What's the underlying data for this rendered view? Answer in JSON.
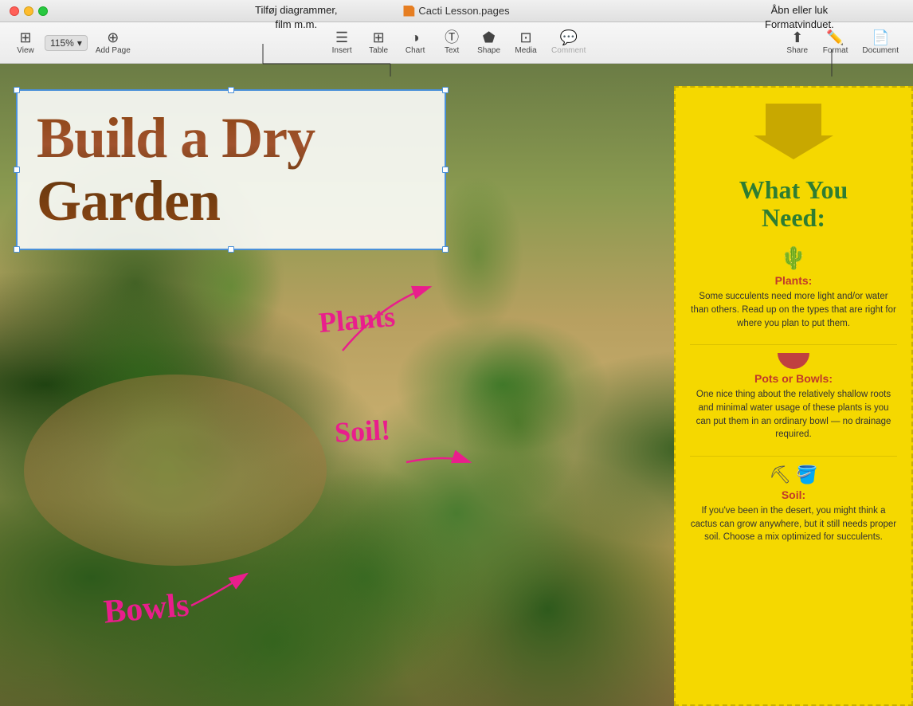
{
  "window": {
    "title": "Cacti Lesson.pages"
  },
  "callouts": {
    "chart_callout": "Tilføj diagrammer,\nfilm m.m.",
    "format_callout": "Åbn eller luk\nFormatvinduet."
  },
  "toolbar": {
    "view_label": "View",
    "zoom_value": "115%",
    "add_page_label": "Add Page",
    "insert_label": "Insert",
    "table_label": "Table",
    "chart_label": "Chart",
    "text_label": "Text",
    "shape_label": "Shape",
    "media_label": "Media",
    "comment_label": "Comment",
    "share_label": "Share",
    "format_label": "Format",
    "document_label": "Document"
  },
  "page_content": {
    "title": "Build a Dry Garden",
    "panel_heading": "What You\nNeed:",
    "plants_title": "Plants:",
    "plants_body": "Some succulents need more light and/or water than others. Read up on the types that are right for where you plan to put them.",
    "pots_title": "Pots or Bowls:",
    "pots_body": "One nice thing about the relatively shallow roots and minimal water usage of these plants is you can put them in an ordinary bowl — no drainage required.",
    "soil_title": "Soil:",
    "soil_body": "If you've been in the desert, you might think a cactus can grow anywhere, but it still needs proper soil. Choose a mix optimized for succulents.",
    "annotation_plants": "Plants",
    "annotation_soil": "Soil!",
    "annotation_bowls": "Bowls"
  }
}
